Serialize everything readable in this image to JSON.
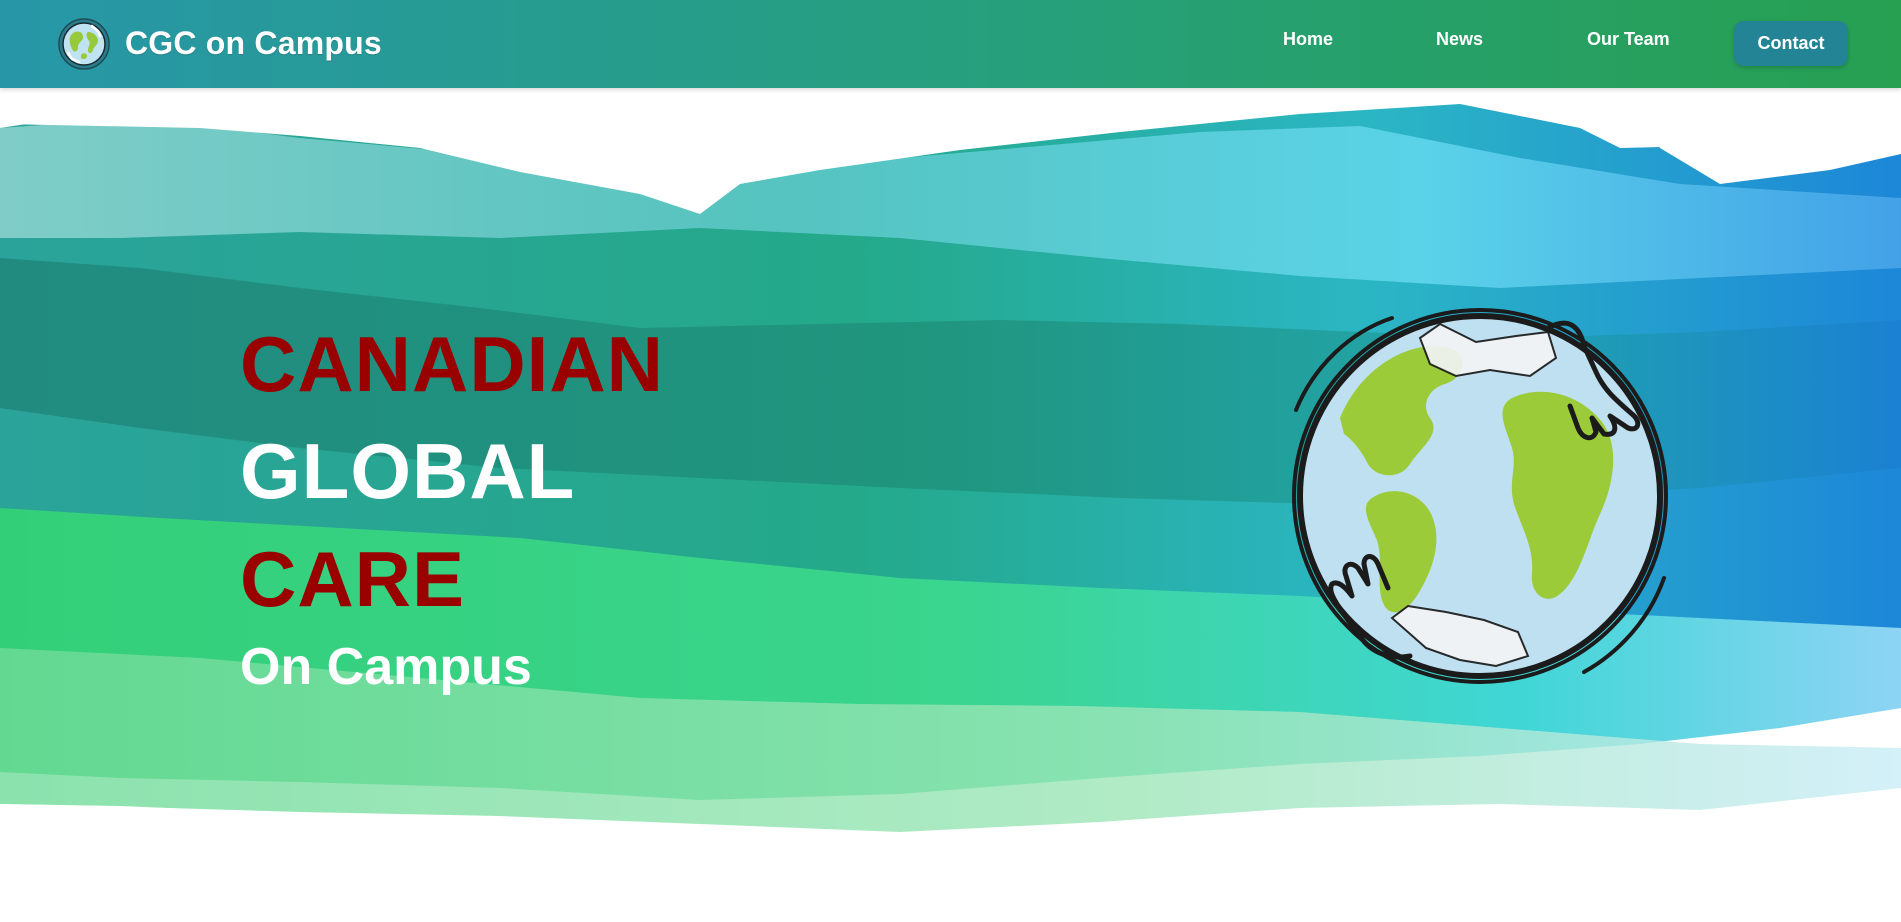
{
  "brand": {
    "title": "CGC on Campus",
    "logo_icon": "globe-hands-icon"
  },
  "nav": {
    "items": [
      {
        "label": "Home"
      },
      {
        "label": "News"
      },
      {
        "label": "Our Team"
      }
    ],
    "contact_label": "Contact"
  },
  "hero": {
    "line1": "CANADIAN",
    "line2": "GLOBAL",
    "line3": "CARE",
    "subtitle": "On Campus",
    "illustration_icon": "globe-held-by-hands-icon"
  },
  "colors": {
    "nav_gradient_start": "#2797a8",
    "nav_gradient_end": "#27a052",
    "contact_button": "#238495",
    "accent_red": "#990000",
    "white": "#ffffff"
  }
}
